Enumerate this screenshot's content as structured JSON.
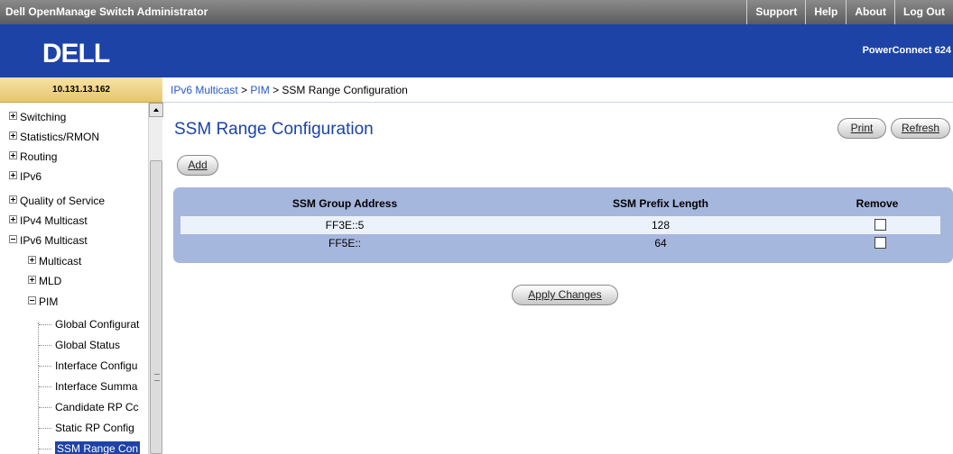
{
  "app": {
    "title": "Dell OpenManage Switch Administrator",
    "top_links": [
      "Support",
      "Help",
      "About",
      "Log Out"
    ],
    "product": "PowerConnect 624",
    "logo_text": "DELL",
    "ip_address": "10.131.13.162"
  },
  "breadcrumb": {
    "items": [
      "IPv6 Multicast",
      "PIM",
      "SSM Range Configuration"
    ],
    "separator": " > "
  },
  "sidebar": {
    "items": [
      {
        "label": "Switching",
        "expander": "plus"
      },
      {
        "label": "Statistics/RMON",
        "expander": "plus"
      },
      {
        "label": "Routing",
        "expander": "plus"
      },
      {
        "label": "IPv6",
        "expander": "plus"
      },
      {
        "label": "Quality of Service",
        "expander": "plus"
      },
      {
        "label": "IPv4 Multicast",
        "expander": "plus"
      },
      {
        "label": "IPv6 Multicast",
        "expander": "minus"
      },
      {
        "label": "Multicast",
        "expander": "plus"
      },
      {
        "label": "MLD",
        "expander": "plus"
      },
      {
        "label": "PIM",
        "expander": "minus"
      },
      {
        "label": "Global Configurat",
        "expander": "none"
      },
      {
        "label": "Global Status",
        "expander": "none"
      },
      {
        "label": "Interface Configu",
        "expander": "none"
      },
      {
        "label": "Interface Summa",
        "expander": "none"
      },
      {
        "label": "Candidate RP Cc",
        "expander": "none"
      },
      {
        "label": "Static RP Config",
        "expander": "none"
      },
      {
        "label": "SSM Range Con",
        "expander": "none",
        "selected": true
      }
    ]
  },
  "main": {
    "title": "SSM Range Configuration",
    "buttons": {
      "print": "Print",
      "refresh": "Refresh",
      "add": "Add",
      "apply": "Apply Changes"
    },
    "table": {
      "headers": [
        "SSM Group Address",
        "SSM Prefix Length",
        "Remove"
      ],
      "rows": [
        {
          "address": "FF3E::5",
          "prefix": "128",
          "remove": false
        },
        {
          "address": "FF5E::",
          "prefix": "64",
          "remove": false
        }
      ]
    }
  },
  "colors": {
    "brand_blue": "#1d43a6",
    "link_blue": "#2957c7",
    "table_bg": "#a6b7dd",
    "ip_box": "#f0d88a"
  }
}
